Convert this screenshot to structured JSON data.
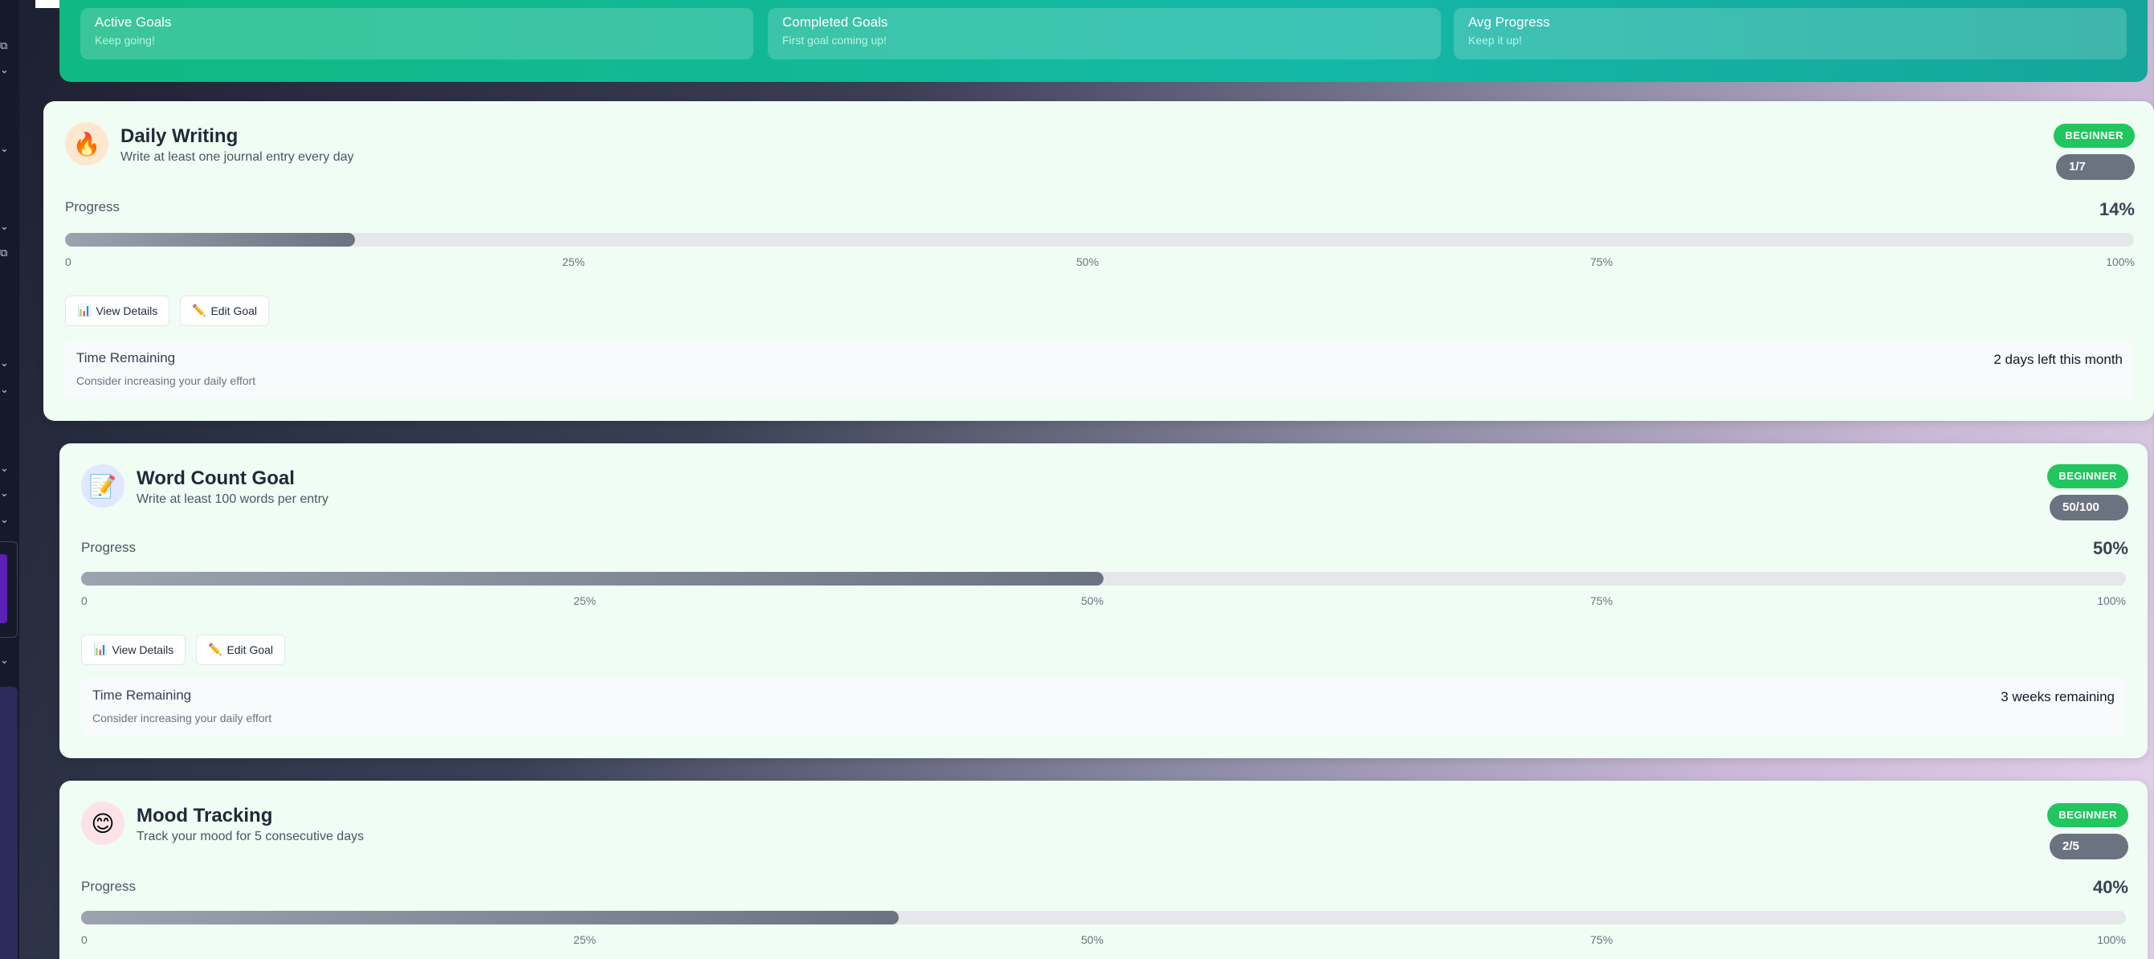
{
  "stats": [
    {
      "title": "Active Goals",
      "subtitle": "Keep going!"
    },
    {
      "title": "Completed Goals",
      "subtitle": "First goal coming up!"
    },
    {
      "title": "Avg Progress",
      "subtitle": "Keep it up!"
    }
  ],
  "ticks": [
    "0",
    "25%",
    "50%",
    "75%",
    "100%"
  ],
  "labels": {
    "progress": "Progress",
    "view_details": "View Details",
    "edit_goal": "Edit Goal",
    "time_remaining": "Time Remaining"
  },
  "goals": [
    {
      "icon": "fire-icon",
      "icon_glyph": "🔥",
      "title": "Daily Writing",
      "description": "Write at least one journal entry every day",
      "level": "BEGINNER",
      "count": "1/7",
      "progress_pct": "14%",
      "progress_value": 14,
      "time_value": "2 days left this month",
      "time_hint": "Consider increasing your daily effort"
    },
    {
      "icon": "memo-icon",
      "icon_glyph": "📝",
      "title": "Word Count Goal",
      "description": "Write at least 100 words per entry",
      "level": "BEGINNER",
      "count": "50/100",
      "progress_pct": "50%",
      "progress_value": 50,
      "time_value": "3 weeks remaining",
      "time_hint": "Consider increasing your daily effort"
    },
    {
      "icon": "smile-icon",
      "icon_glyph": "😊",
      "title": "Mood Tracking",
      "description": "Track your mood for 5 consecutive days",
      "level": "BEGINNER",
      "count": "2/5",
      "progress_pct": "40%",
      "progress_value": 40
    }
  ],
  "icons": {
    "chart": "📊",
    "pencil": "✏️"
  },
  "colors": {
    "accent_green": "#22c55e",
    "stats_gradient_start": "#10b981",
    "stats_gradient_end": "#14a69a",
    "badge_gray": "#6b7280",
    "card_bg": "#effdf4"
  }
}
